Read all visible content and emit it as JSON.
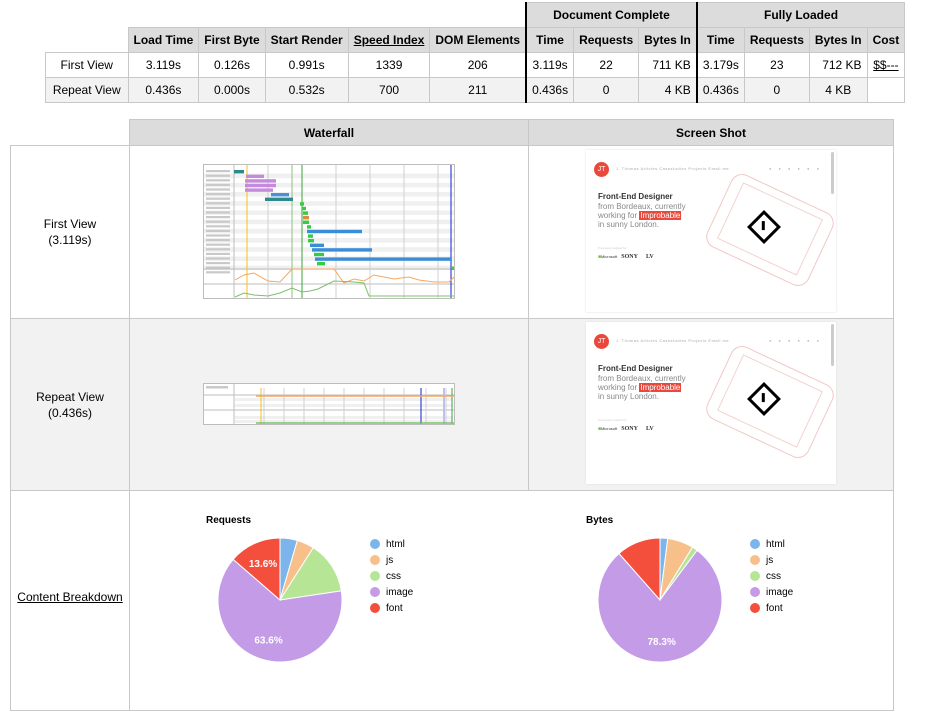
{
  "summary": {
    "group_headers": {
      "document_complete": "Document Complete",
      "fully_loaded": "Fully Loaded"
    },
    "columns": [
      "Load Time",
      "First Byte",
      "Start Render",
      "Speed Index",
      "DOM Elements",
      "Time",
      "Requests",
      "Bytes In",
      "Time",
      "Requests",
      "Bytes In",
      "Cost"
    ],
    "rows": [
      {
        "label": "First View",
        "values": [
          "3.119s",
          "0.126s",
          "0.991s",
          "1339",
          "206",
          "3.119s",
          "22",
          "711 KB",
          "3.179s",
          "23",
          "712 KB",
          "$$---"
        ]
      },
      {
        "label": "Repeat View",
        "values": [
          "0.436s",
          "0.000s",
          "0.532s",
          "700",
          "211",
          "0.436s",
          "0",
          "4 KB",
          "0.436s",
          "0",
          "4 KB",
          ""
        ]
      }
    ]
  },
  "results": {
    "headers": {
      "waterfall": "Waterfall",
      "screenshot": "Screen Shot"
    },
    "first_view": {
      "label": "First View",
      "time": "(3.119s)"
    },
    "repeat_view": {
      "label": "Repeat View",
      "time": "(0.436s)"
    },
    "content_breakdown": {
      "label": "Content Breakdown"
    },
    "screenshot_text": {
      "nav": "J. Thomas   Articles   Casestudies   Projects   Email me",
      "headline": "Front-End Designer",
      "line1": "from Bordeaux, currently",
      "line2_pre": "working for ",
      "line2_highlight": "Improbable",
      "line3": "in sunny London.",
      "trusted": "Previously worked for",
      "brand1": "Microsoft",
      "brand2": "SONY",
      "brand3": "LV"
    }
  },
  "colors": {
    "html": "#7cb5ec",
    "js": "#f7c08a",
    "css": "#b5e595",
    "image": "#c49be6",
    "font": "#f44e3c"
  },
  "chart_data": [
    {
      "type": "pie",
      "title": "Requests",
      "legend_position": "right",
      "categories": [
        "html",
        "js",
        "css",
        "image",
        "font"
      ],
      "values": [
        4.5,
        4.5,
        13.6,
        63.6,
        13.6
      ],
      "labels_shown": [
        "",
        "",
        "",
        "63.6%",
        "13.6%"
      ]
    },
    {
      "type": "pie",
      "title": "Bytes",
      "legend_position": "right",
      "categories": [
        "html",
        "js",
        "css",
        "image",
        "font"
      ],
      "values": [
        2.0,
        6.8,
        1.4,
        78.3,
        11.5
      ],
      "labels_shown": [
        "",
        "",
        "",
        "78.3%",
        ""
      ]
    }
  ]
}
